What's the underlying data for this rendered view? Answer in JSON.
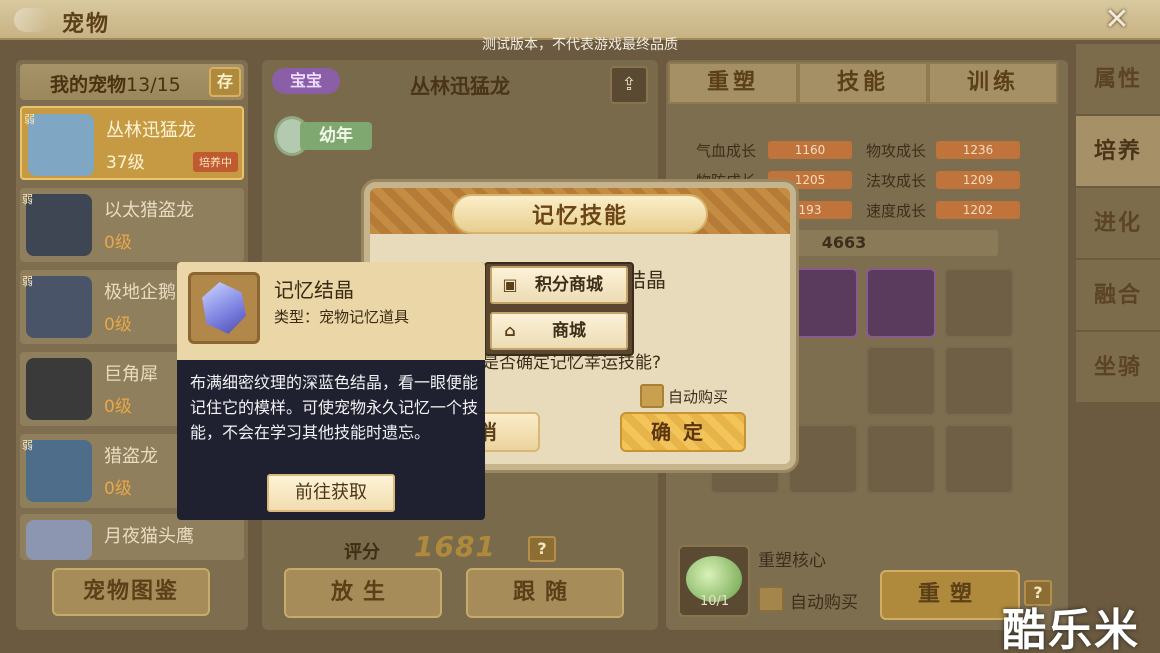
{
  "header": {
    "title": "宠物",
    "close_icon": "close-icon",
    "test_notice": "测试版本，不代表游戏最终品质"
  },
  "left": {
    "title": "我的宠物",
    "count": "13/15",
    "store_label": "存",
    "pets": [
      {
        "name": "丛林迅猛龙",
        "level": "37级",
        "badge": "弱",
        "status": "培养中",
        "selected": true
      },
      {
        "name": "以太猎盗龙",
        "level": "0级",
        "badge": "弱"
      },
      {
        "name": "极地企鹅",
        "level": "0级",
        "badge": "弱"
      },
      {
        "name": "巨角犀",
        "level": "0级"
      },
      {
        "name": "猎盗龙",
        "level": "0级",
        "badge": "弱"
      },
      {
        "name": "月夜猫头鹰",
        "level": ""
      }
    ],
    "atlas_label": "宠物图鉴"
  },
  "middle": {
    "baby_tag": "宝宝",
    "pet_name": "丛林迅猛龙",
    "stage": "幼年",
    "score_label": "评分",
    "score_value": "1681",
    "help_label": "?",
    "release_label": "放生",
    "follow_label": "跟随"
  },
  "right": {
    "tabs": [
      "重塑",
      "技能",
      "训练"
    ],
    "stats": [
      {
        "label": "气血成长",
        "value": "1160"
      },
      {
        "label": "物攻成长",
        "value": "1236"
      },
      {
        "label": "物防成长",
        "value": "1205"
      },
      {
        "label": "法攻成长",
        "value": "1209"
      },
      {
        "label": "",
        "value": "193"
      },
      {
        "label": "速度成长",
        "value": "1202"
      }
    ],
    "total": "4663",
    "core_label": "重塑核心",
    "core_count": "10/1",
    "auto_buy_label": "自动购买",
    "reshape_label": "重塑",
    "help_label": "?"
  },
  "side_tabs": [
    {
      "label": "属性",
      "active": false
    },
    {
      "label": "培养",
      "active": true
    },
    {
      "label": "进化",
      "active": false
    },
    {
      "label": "融合",
      "active": false
    },
    {
      "label": "坐骑",
      "active": false
    }
  ],
  "dialog": {
    "title": "记忆技能",
    "item_name_partial": "结晶",
    "question": "是否确定记忆幸运技能?",
    "auto_buy_label": "自动购买",
    "cancel_label": "取消",
    "confirm_label": "确定"
  },
  "shop_popup": {
    "points_shop": "积分商城",
    "shop": "商城"
  },
  "tooltip": {
    "name": "记忆结晶",
    "type": "类型：宠物记忆道具",
    "description": "布满细密纹理的深蓝色结晶，看一眼便能记住它的模样。可使宠物永久记忆一个技能，不会在学习其他技能时遗忘。",
    "goto_label": "前往获取"
  },
  "watermark": "酷乐米"
}
